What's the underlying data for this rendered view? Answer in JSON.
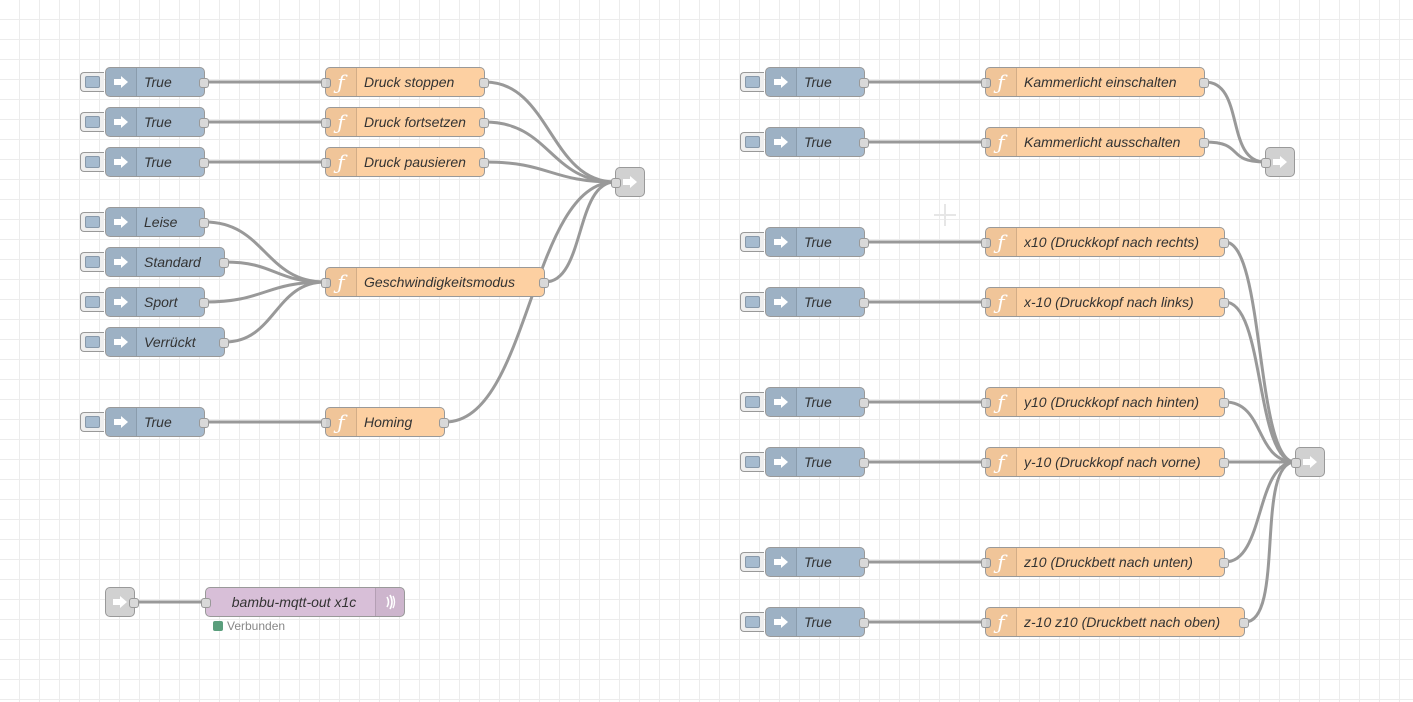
{
  "colors": {
    "inject": "#a6bbcf",
    "function": "#fdd0a2",
    "link": "#dddddd",
    "mqtt": "#d8bfd8",
    "wire": "#999999",
    "status_connected": "#5a9e7c"
  },
  "icons": {
    "inject": "inject-arrow-icon",
    "function": "function-f-icon",
    "link": "link-arrow-icon",
    "mqtt": "radio-waves-icon"
  },
  "printer_flow": {
    "inject_stop": "True",
    "inject_resume": "True",
    "inject_pause": "True",
    "inject_leise": "Leise",
    "inject_standard": "Standard",
    "inject_sport": "Sport",
    "inject_verrueckt": "Verrückt",
    "inject_homing": "True",
    "func_stop": "Druck stoppen",
    "func_resume": "Druck fortsetzen",
    "func_pause": "Druck pausieren",
    "func_speed": "Geschwindigkeitsmodus",
    "func_homing": "Homing"
  },
  "light_flow": {
    "inject_on": "True",
    "inject_off": "True",
    "func_on": "Kammerlicht einschalten",
    "func_off": "Kammerlicht ausschalten"
  },
  "motion_flow": {
    "inject_x10": "True",
    "inject_xm10": "True",
    "inject_y10": "True",
    "inject_ym10": "True",
    "inject_z10": "True",
    "inject_zm10": "True",
    "func_x10": "x10 (Druckkopf nach rechts)",
    "func_xm10": "x-10 (Druckkopf nach links)",
    "func_y10": "y10 (Druckkopf nach hinten)",
    "func_ym10": "y-10 (Druckkopf nach vorne)",
    "func_z10": "z10 (Druckbett nach unten)",
    "func_zm10": "z-10 z10 (Druckbett nach oben)"
  },
  "mqtt": {
    "label": "bambu-mqtt-out x1c",
    "status": "Verbunden"
  }
}
